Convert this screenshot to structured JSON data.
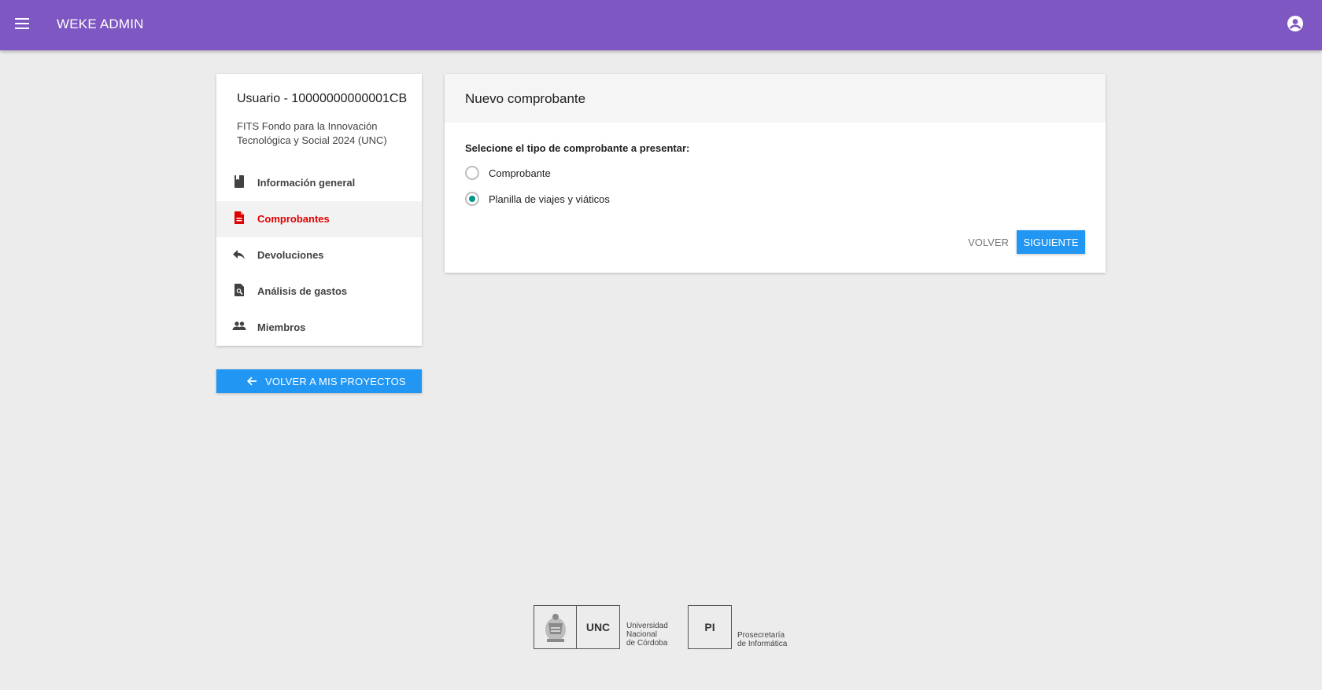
{
  "topbar": {
    "title": "WEKE ADMIN",
    "menu_icon": "menu-icon",
    "account_icon": "account-circle-icon"
  },
  "sidebar": {
    "user_name": "Usuario - 10000000000001CB",
    "project_name": "FITS Fondo para la Innovación Tecnológica y Social 2024 (UNC)",
    "items": [
      {
        "label": "Información general",
        "icon": "book-icon",
        "active": false
      },
      {
        "label": "Comprobantes",
        "icon": "document-icon",
        "active": true
      },
      {
        "label": "Devoluciones",
        "icon": "reply-icon",
        "active": false
      },
      {
        "label": "Análisis de gastos",
        "icon": "search-document-icon",
        "active": false
      },
      {
        "label": "Miembros",
        "icon": "people-icon",
        "active": false
      }
    ],
    "back_button": "VOLVER A MIS PROYECTOS"
  },
  "main": {
    "title": "Nuevo comprobante",
    "question": "Selecione el tipo de comprobante a presentar:",
    "options": [
      {
        "label": "Comprobante",
        "selected": false
      },
      {
        "label": "Planilla de viajes y viáticos",
        "selected": true
      }
    ],
    "back_button": "VOLVER",
    "next_button": "SIGUIENTE"
  },
  "footer": {
    "unc_abbr": "UNC",
    "unc_name": [
      "Universidad",
      "Nacional",
      "de Córdoba"
    ],
    "pi_abbr": "PI",
    "pi_name": [
      "Prosecretaría",
      "de Informática"
    ]
  },
  "colors": {
    "topbar": "#7e57c2",
    "primary_button": "#2196f3",
    "active_nav": "#e00000",
    "radio_checked": "#009688"
  }
}
